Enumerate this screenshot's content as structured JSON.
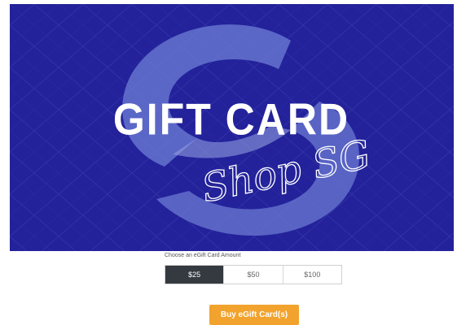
{
  "banner": {
    "title": "GIFT CARD",
    "script_text": "Shop SG"
  },
  "amount": {
    "label": "Choose an eGift Card Amount",
    "options": [
      "$25",
      "$50",
      "$100"
    ],
    "selected": "$25"
  },
  "buy_button": {
    "label": "Buy eGift Card(s)"
  },
  "colors": {
    "banner_background": "#23229a",
    "selected_option": "#343a40",
    "buy_button": "#f2a32d"
  }
}
